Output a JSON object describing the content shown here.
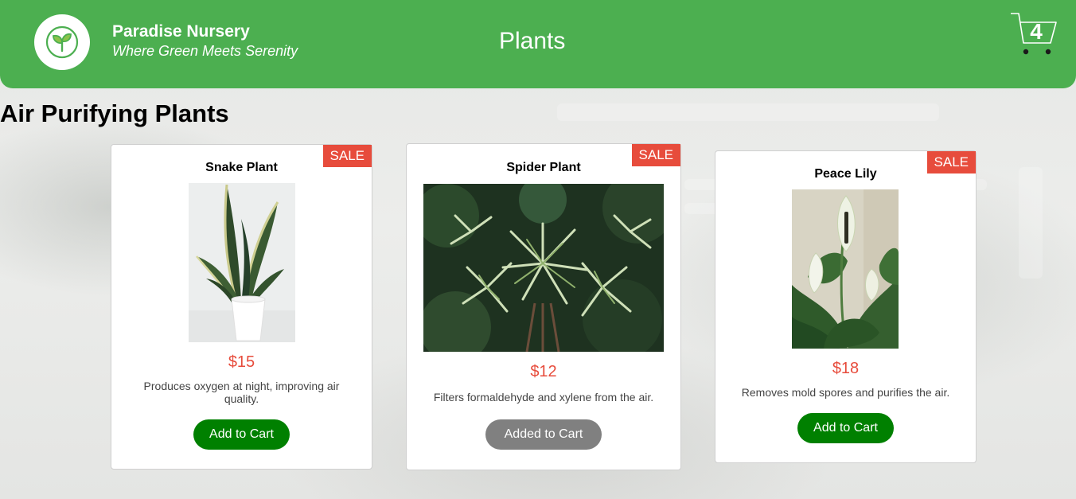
{
  "header": {
    "brand_name": "Paradise Nursery",
    "brand_tagline": "Where Green Meets Serenity",
    "nav_title": "Plants",
    "cart_count": "4",
    "logo_icon": "sprout-icon",
    "cart_icon": "cart-icon",
    "color": "#4caf50"
  },
  "category": {
    "title": "Air Purifying Plants"
  },
  "plants": [
    {
      "badge": "SALE",
      "name": "Snake Plant",
      "price": "$15",
      "description": "Produces oxygen at night, improving air quality.",
      "button_label": "Add to Cart",
      "button_state": "add"
    },
    {
      "badge": "SALE",
      "name": "Spider Plant",
      "price": "$12",
      "description": "Filters formaldehyde and xylene from the air.",
      "button_label": "Added to Cart",
      "button_state": "added"
    },
    {
      "badge": "SALE",
      "name": "Peace Lily",
      "price": "$18",
      "description": "Removes mold spores and purifies the air.",
      "button_label": "Add to Cart",
      "button_state": "add"
    }
  ],
  "colors": {
    "sale": "#e74c3c",
    "price": "#e74c3c",
    "add_button": "#008000",
    "added_button": "#808080"
  }
}
